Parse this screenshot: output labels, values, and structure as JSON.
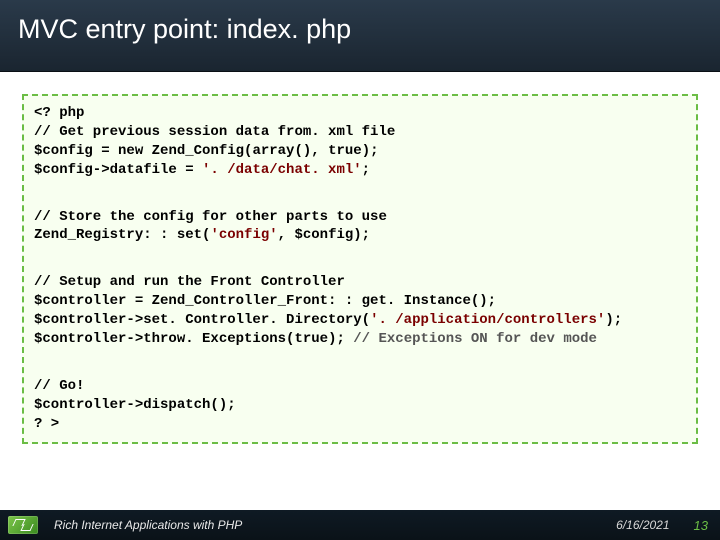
{
  "header": {
    "title": "MVC entry point: index. php"
  },
  "code": {
    "l1": "<? php",
    "l2": "// Get previous session data from. xml file",
    "l3a": "$config = ",
    "l3b": "new",
    "l3c": " Zend_Config(array(), ",
    "l3d": "true",
    "l3e": ");",
    "l4a": "$config->datafile = ",
    "l4b": "'. /data/chat. xml'",
    "l4c": ";",
    "l5": "// Store the config for other parts to use",
    "l6a": "Zend_Registry: : set(",
    "l6b": "'config'",
    "l6c": ", $config);",
    "l7": "// Setup and run the Front Controller",
    "l8": "$controller = Zend_Controller_Front: : get. Instance();",
    "l9a": "$controller->set. Controller. Directory(",
    "l9b": "'. /application/controllers'",
    "l9c": ");",
    "l10a": "$controller->throw. Exceptions(",
    "l10b": "true",
    "l10c": ");  ",
    "l10d": "// Exceptions ON for dev mode",
    "l11": "// Go!",
    "l12": "$controller->dispatch();",
    "l13": "? >"
  },
  "footer": {
    "title": "Rich Internet Applications with PHP",
    "date": "6/16/2021",
    "page": "13"
  }
}
